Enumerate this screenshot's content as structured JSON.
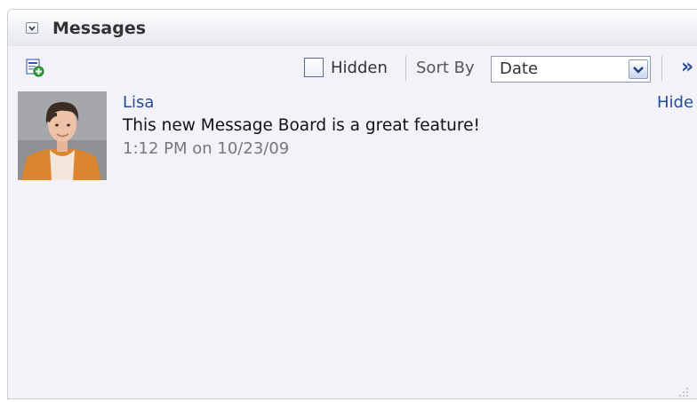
{
  "panel": {
    "title": "Messages"
  },
  "toolbar": {
    "add_icon": "add-message-icon",
    "hidden_label": "Hidden",
    "hidden_checked": false,
    "sort_by_label": "Sort By",
    "sort_value": "Date",
    "overflow_label": "»"
  },
  "messages": [
    {
      "author": "Lisa",
      "text": "This new Message Board is a great feature!",
      "time": "1:12 PM on 10/23/09",
      "hide_label": "Hide"
    }
  ],
  "colors": {
    "link": "#244c9a",
    "panel_bg": "#f3f2f8",
    "timestamp": "#777777"
  }
}
